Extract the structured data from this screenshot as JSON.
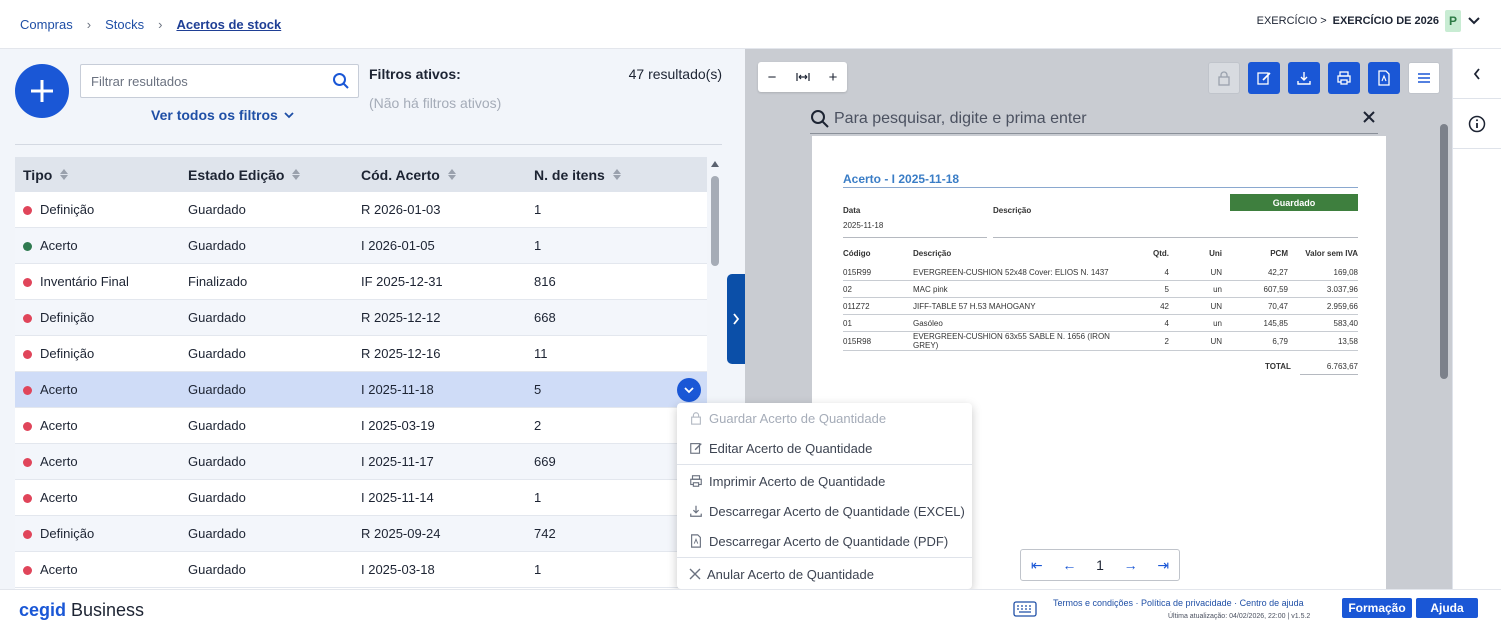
{
  "breadcrumb": {
    "items": [
      "Compras",
      "Stocks"
    ],
    "current": "Acertos de stock"
  },
  "exercise": {
    "prefix": "EXERCÍCIO >",
    "value": "EXERCÍCIO DE 2026",
    "avatar": "P"
  },
  "list": {
    "search_placeholder": "Filtrar resultados",
    "all_filters": "Ver todos os filtros",
    "active_filters_label": "Filtros ativos:",
    "no_filters": "(Não há filtros ativos)",
    "result_count": "47 resultado(s)",
    "columns": [
      "Tipo",
      "Estado Edição",
      "Cód. Acerto",
      "N. de itens"
    ],
    "rows": [
      {
        "tipo": "Definição",
        "estado": "Guardado",
        "codigo": "R 2026-01-03",
        "itens": "1",
        "dot": "#e0455a"
      },
      {
        "tipo": "Acerto",
        "estado": "Guardado",
        "codigo": "I 2026-01-05",
        "itens": "1",
        "dot": "#2f7a50"
      },
      {
        "tipo": "Inventário Final",
        "estado": "Finalizado",
        "codigo": "IF 2025-12-31",
        "itens": "816",
        "dot": "#e0455a"
      },
      {
        "tipo": "Definição",
        "estado": "Guardado",
        "codigo": "R 2025-12-12",
        "itens": "668",
        "dot": "#e0455a"
      },
      {
        "tipo": "Definição",
        "estado": "Guardado",
        "codigo": "R 2025-12-16",
        "itens": "11",
        "dot": "#e0455a"
      },
      {
        "tipo": "Acerto",
        "estado": "Guardado",
        "codigo": "I 2025-11-18",
        "itens": "5",
        "dot": "#e0455a"
      },
      {
        "tipo": "Acerto",
        "estado": "Guardado",
        "codigo": "I 2025-03-19",
        "itens": "2",
        "dot": "#e0455a"
      },
      {
        "tipo": "Acerto",
        "estado": "Guardado",
        "codigo": "I 2025-11-17",
        "itens": "669",
        "dot": "#e0455a"
      },
      {
        "tipo": "Acerto",
        "estado": "Guardado",
        "codigo": "I 2025-11-14",
        "itens": "1",
        "dot": "#e0455a"
      },
      {
        "tipo": "Definição",
        "estado": "Guardado",
        "codigo": "R 2025-09-24",
        "itens": "742",
        "dot": "#e0455a"
      },
      {
        "tipo": "Acerto",
        "estado": "Guardado",
        "codigo": "I 2025-03-18",
        "itens": "1",
        "dot": "#e0455a"
      }
    ]
  },
  "context_menu": {
    "items": [
      {
        "label": "Guardar Acerto de Quantidade",
        "icon": "lock-icon",
        "disabled": true
      },
      {
        "label": "Editar Acerto de Quantidade",
        "icon": "edit-icon"
      },
      {
        "label": "Imprimir Acerto de Quantidade",
        "icon": "print-icon"
      },
      {
        "label": "Descarregar Acerto de Quantidade (EXCEL)",
        "icon": "download-icon"
      },
      {
        "label": "Descarregar Acerto de Quantidade (PDF)",
        "icon": "pdf-icon"
      },
      {
        "label": "Anular Acerto de Quantidade",
        "icon": "close-icon"
      }
    ]
  },
  "viewer": {
    "search_placeholder": "Para pesquisar, digite e prima enter",
    "page_number": "1",
    "document": {
      "title": "Acerto - I 2025-11-18",
      "status": "Guardado",
      "data_label": "Data",
      "data_value": "2025-11-18",
      "descricao_label": "Descrição",
      "columns": [
        "Código",
        "Descrição",
        "Qtd.",
        "Uni",
        "PCM",
        "Valor sem IVA"
      ],
      "lines": [
        {
          "codigo": "015R99",
          "descricao": "EVERGREEN-CUSHION 52x48 Cover: ELIOS N. 1437",
          "qtd": "4",
          "uni": "UN",
          "pcm": "42,27",
          "valor": "169,08"
        },
        {
          "codigo": "02",
          "descricao": "MAC pink",
          "qtd": "5",
          "uni": "un",
          "pcm": "607,59",
          "valor": "3.037,96"
        },
        {
          "codigo": "011Z72",
          "descricao": "JIFF-TABLE 57 H.53 MAHOGANY",
          "qtd": "42",
          "uni": "UN",
          "pcm": "70,47",
          "valor": "2.959,66"
        },
        {
          "codigo": "01",
          "descricao": "Gasóleo",
          "qtd": "4",
          "uni": "un",
          "pcm": "145,85",
          "valor": "583,40"
        },
        {
          "codigo": "015R98",
          "descricao": "EVERGREEN-CUSHION 63x55 SABLE N. 1656 (IRON GREY)",
          "qtd": "2",
          "uni": "UN",
          "pcm": "6,79",
          "valor": "13,58"
        }
      ],
      "total_label": "TOTAL",
      "total_value": "6.763,67"
    }
  },
  "footer": {
    "brand_a": "cegid",
    "brand_b": " Business",
    "legal": "Termos e condições · Política de privacidade · Centro de ajuda",
    "updated": "Última atualização: 04/02/2026, 22:00 | v1.5.2",
    "formacao": "Formação",
    "ajuda": "Ajuda"
  },
  "colors": {
    "accent": "#1a57d6",
    "status_saved": "#3e7f3e",
    "dot_red": "#e0455a",
    "dot_green": "#2f7a50"
  }
}
